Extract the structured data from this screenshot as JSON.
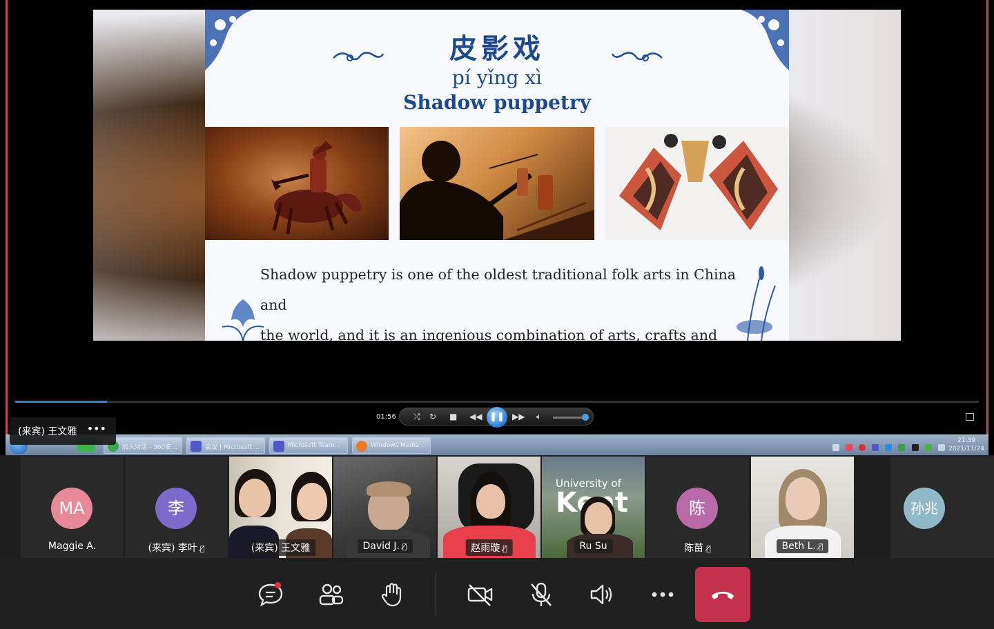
{
  "slide": {
    "title_zh": "皮影戏",
    "pinyin": "pí yǐng xì",
    "title_en": "Shadow puppetry",
    "body_line1": "Shadow puppetry is one of the oldest traditional folk arts in China and",
    "body_line2": "the world, and it is an ingenious combination of arts, crafts and opera."
  },
  "player": {
    "time": "01:56",
    "seek_progress": 0.095,
    "state": "playing",
    "volume_level": 0.9
  },
  "share_tag": {
    "name": "(来宾) 王文雅",
    "more": "•••"
  },
  "taskbar": {
    "tasks": [
      {
        "label": "加入对话 - 360安...",
        "icon": "browser-icon"
      },
      {
        "label": "会议 | Microsoft ...",
        "icon": "teams-icon"
      },
      {
        "label": "Microsoft Team...",
        "icon": "teams-icon"
      },
      {
        "label": "Windows Media...",
        "icon": "media-player-icon"
      }
    ],
    "clock_time": "21:39",
    "clock_date": "2021/11/24"
  },
  "participants": [
    {
      "name": "Maggie A.",
      "initials": "MA",
      "color": "#e8899a",
      "muted": false,
      "video": false
    },
    {
      "name": "(来宾) 李叶",
      "initials": "李",
      "color": "#7b6ac9",
      "muted": true,
      "video": false
    },
    {
      "name": "(来宾) 王文雅",
      "muted": false,
      "video": true,
      "active": true
    },
    {
      "name": "David J.",
      "muted": true,
      "video": true
    },
    {
      "name": "赵雨璇",
      "muted": true,
      "video": true
    },
    {
      "name": "Ru Su",
      "muted": false,
      "video": true,
      "background_text_1": "University of",
      "background_text_2": "Kent"
    },
    {
      "name": "陈苗",
      "initials": "陈",
      "color": "#b86aa8",
      "muted": true,
      "video": false
    },
    {
      "name": "Beth L.",
      "muted": true,
      "video": true
    },
    {
      "name": "",
      "initials": "孙兆",
      "color": "#8fb8c8",
      "muted": false,
      "video": false
    }
  ],
  "controls": {
    "chat": "chat-icon",
    "people": "people-icon",
    "raise_hand": "raise-hand-icon",
    "camera": "camera-off-icon",
    "mic": "mic-off-icon",
    "speaker": "speaker-icon",
    "more": "more-icon",
    "leave": "hang-up-icon",
    "chat_notification_color": "#e0333f",
    "leave_color": "#c4314b"
  }
}
